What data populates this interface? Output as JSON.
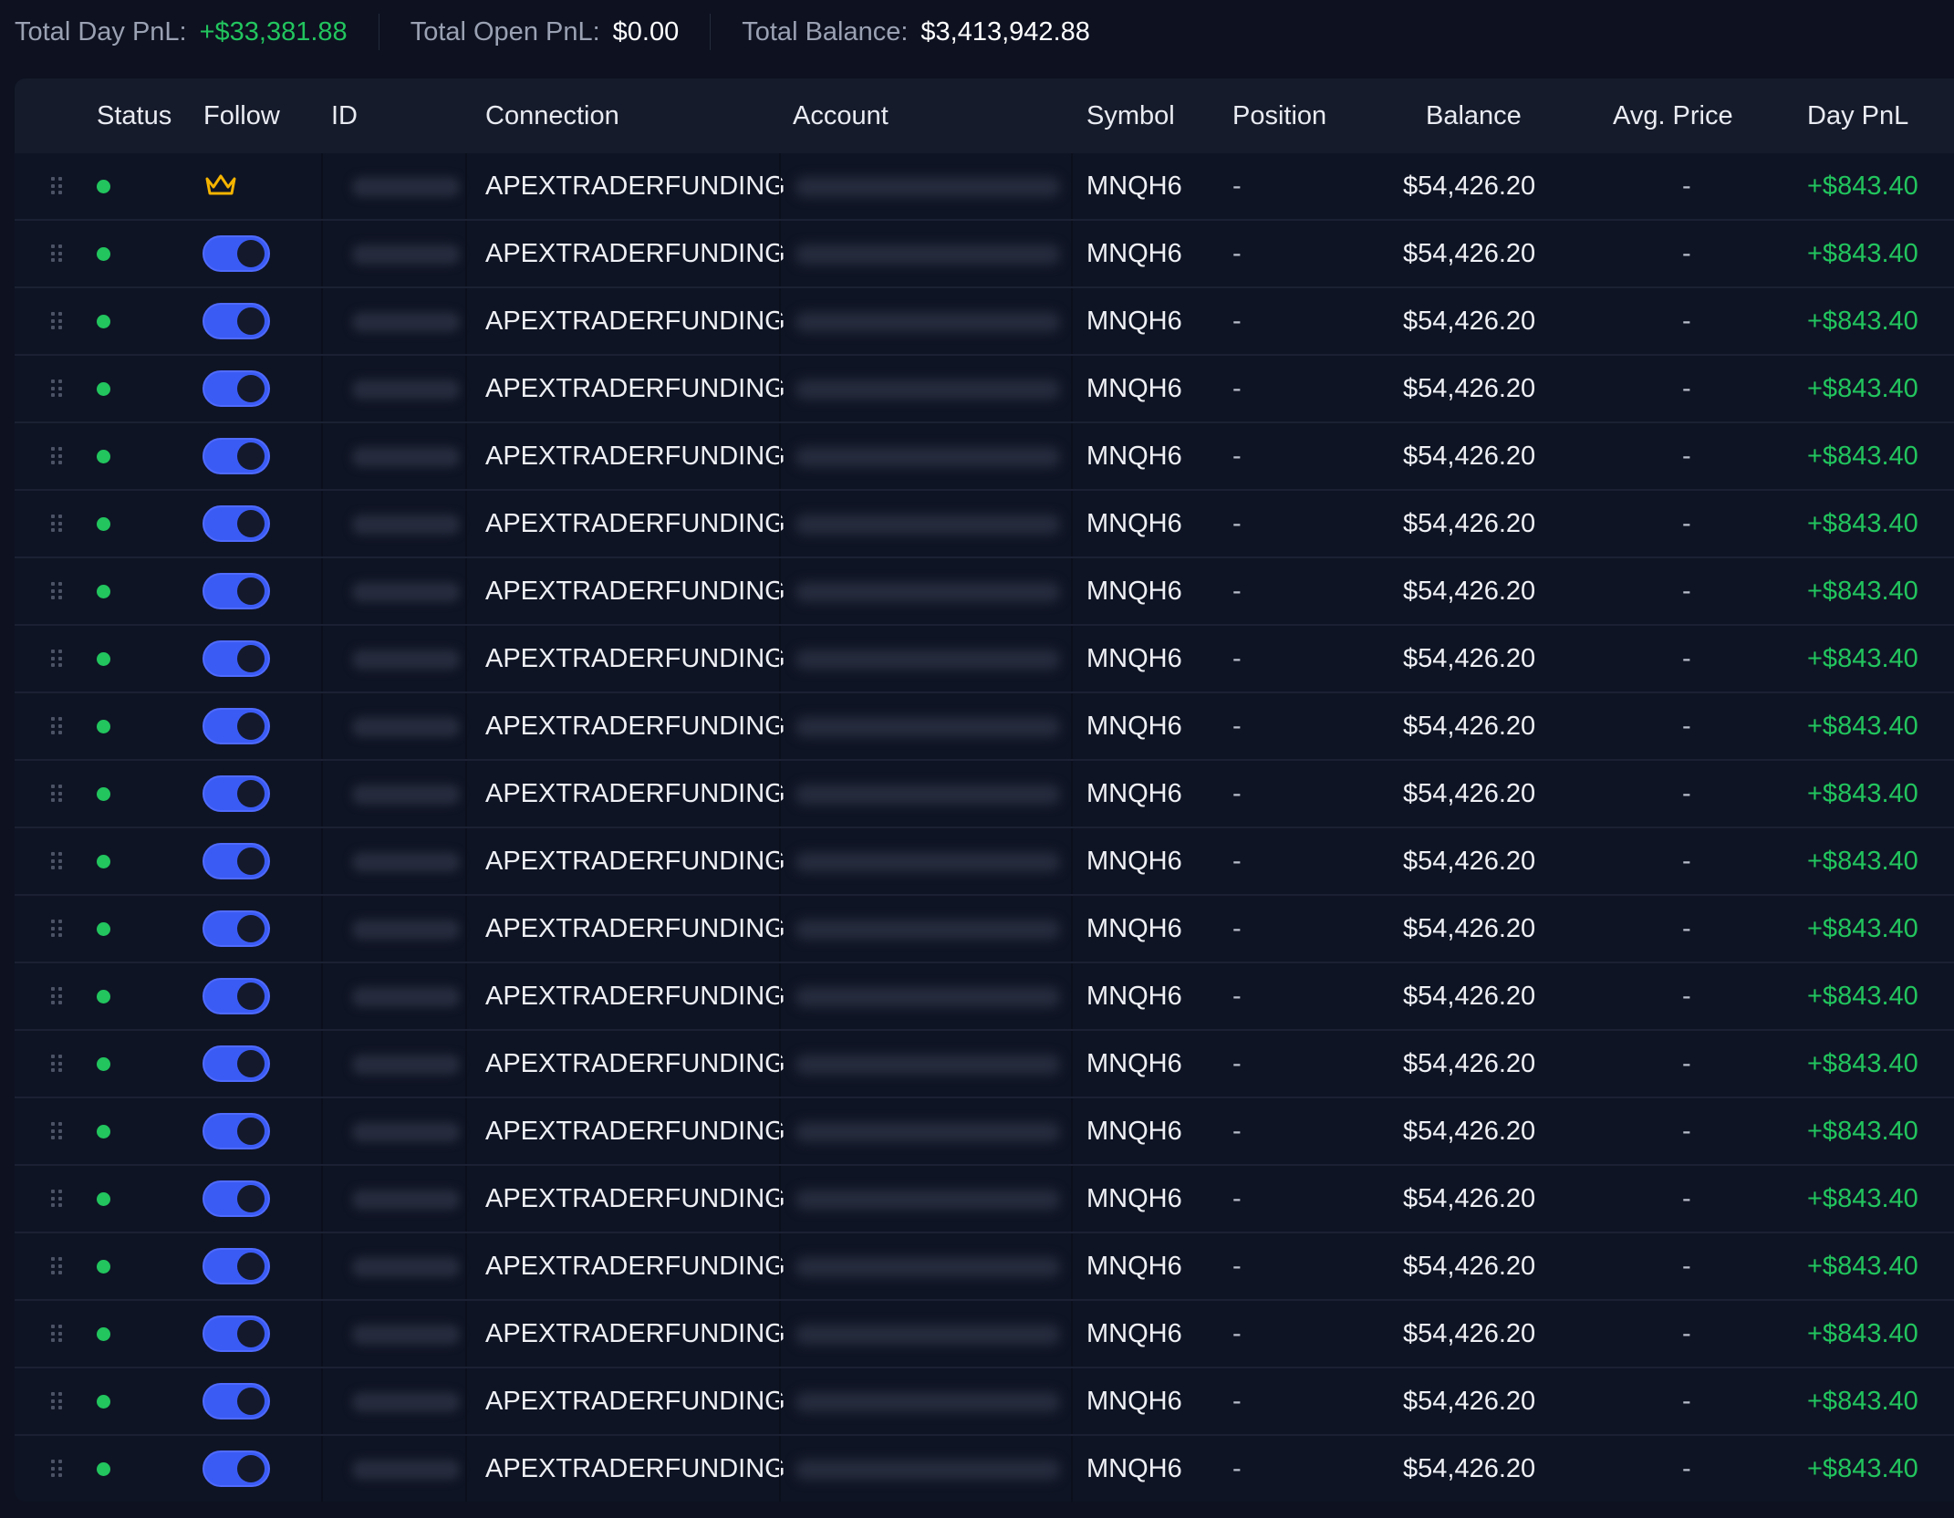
{
  "summary": {
    "day_pnl_label": "Total Day PnL:",
    "day_pnl_value": "+$33,381.88",
    "open_pnl_label": "Total Open PnL:",
    "open_pnl_value": "$0.00",
    "balance_label": "Total Balance:",
    "balance_value": "$3,413,942.88"
  },
  "columns": {
    "status": "Status",
    "follow": "Follow",
    "id": "ID",
    "connection": "Connection",
    "account": "Account",
    "symbol": "Symbol",
    "position": "Position",
    "balance": "Balance",
    "avg_price": "Avg. Price",
    "day_pnl": "Day PnL"
  },
  "colors": {
    "positive": "#22c55e",
    "toggle_on": "#3b5bf5",
    "crown": "#f5b400",
    "status_online": "#22c55e"
  },
  "rows": [
    {
      "follow": "leader",
      "follow_icon": "crown-icon",
      "connection": "APEXTRADERFUNDING",
      "symbol": "MNQH6",
      "position": "-",
      "balance": "$54,426.20",
      "avg_price": "-",
      "day_pnl": "+$843.40"
    },
    {
      "follow": "on",
      "connection": "APEXTRADERFUNDING",
      "symbol": "MNQH6",
      "position": "-",
      "balance": "$54,426.20",
      "avg_price": "-",
      "day_pnl": "+$843.40"
    },
    {
      "follow": "on",
      "connection": "APEXTRADERFUNDING",
      "symbol": "MNQH6",
      "position": "-",
      "balance": "$54,426.20",
      "avg_price": "-",
      "day_pnl": "+$843.40"
    },
    {
      "follow": "on",
      "connection": "APEXTRADERFUNDING",
      "symbol": "MNQH6",
      "position": "-",
      "balance": "$54,426.20",
      "avg_price": "-",
      "day_pnl": "+$843.40"
    },
    {
      "follow": "on",
      "connection": "APEXTRADERFUNDING",
      "symbol": "MNQH6",
      "position": "-",
      "balance": "$54,426.20",
      "avg_price": "-",
      "day_pnl": "+$843.40"
    },
    {
      "follow": "on",
      "connection": "APEXTRADERFUNDING",
      "symbol": "MNQH6",
      "position": "-",
      "balance": "$54,426.20",
      "avg_price": "-",
      "day_pnl": "+$843.40"
    },
    {
      "follow": "on",
      "connection": "APEXTRADERFUNDING",
      "symbol": "MNQH6",
      "position": "-",
      "balance": "$54,426.20",
      "avg_price": "-",
      "day_pnl": "+$843.40"
    },
    {
      "follow": "on",
      "connection": "APEXTRADERFUNDING",
      "symbol": "MNQH6",
      "position": "-",
      "balance": "$54,426.20",
      "avg_price": "-",
      "day_pnl": "+$843.40"
    },
    {
      "follow": "on",
      "connection": "APEXTRADERFUNDING",
      "symbol": "MNQH6",
      "position": "-",
      "balance": "$54,426.20",
      "avg_price": "-",
      "day_pnl": "+$843.40"
    },
    {
      "follow": "on",
      "connection": "APEXTRADERFUNDING",
      "symbol": "MNQH6",
      "position": "-",
      "balance": "$54,426.20",
      "avg_price": "-",
      "day_pnl": "+$843.40"
    },
    {
      "follow": "on",
      "connection": "APEXTRADERFUNDING",
      "symbol": "MNQH6",
      "position": "-",
      "balance": "$54,426.20",
      "avg_price": "-",
      "day_pnl": "+$843.40"
    },
    {
      "follow": "on",
      "connection": "APEXTRADERFUNDING",
      "symbol": "MNQH6",
      "position": "-",
      "balance": "$54,426.20",
      "avg_price": "-",
      "day_pnl": "+$843.40"
    },
    {
      "follow": "on",
      "connection": "APEXTRADERFUNDING",
      "symbol": "MNQH6",
      "position": "-",
      "balance": "$54,426.20",
      "avg_price": "-",
      "day_pnl": "+$843.40"
    },
    {
      "follow": "on",
      "connection": "APEXTRADERFUNDING",
      "symbol": "MNQH6",
      "position": "-",
      "balance": "$54,426.20",
      "avg_price": "-",
      "day_pnl": "+$843.40"
    },
    {
      "follow": "on",
      "connection": "APEXTRADERFUNDING",
      "symbol": "MNQH6",
      "position": "-",
      "balance": "$54,426.20",
      "avg_price": "-",
      "day_pnl": "+$843.40"
    },
    {
      "follow": "on",
      "connection": "APEXTRADERFUNDING",
      "symbol": "MNQH6",
      "position": "-",
      "balance": "$54,426.20",
      "avg_price": "-",
      "day_pnl": "+$843.40"
    },
    {
      "follow": "on",
      "connection": "APEXTRADERFUNDING",
      "symbol": "MNQH6",
      "position": "-",
      "balance": "$54,426.20",
      "avg_price": "-",
      "day_pnl": "+$843.40"
    },
    {
      "follow": "on",
      "connection": "APEXTRADERFUNDING",
      "symbol": "MNQH6",
      "position": "-",
      "balance": "$54,426.20",
      "avg_price": "-",
      "day_pnl": "+$843.40"
    },
    {
      "follow": "on",
      "connection": "APEXTRADERFUNDING",
      "symbol": "MNQH6",
      "position": "-",
      "balance": "$54,426.20",
      "avg_price": "-",
      "day_pnl": "+$843.40"
    },
    {
      "follow": "on",
      "connection": "APEXTRADERFUNDING",
      "symbol": "MNQH6",
      "position": "-",
      "balance": "$54,426.20",
      "avg_price": "-",
      "day_pnl": "+$843.40"
    }
  ]
}
